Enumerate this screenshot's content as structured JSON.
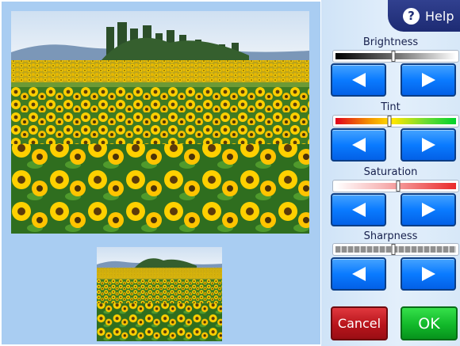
{
  "header": {
    "help_label": "Help",
    "help_icon": "question-mark-icon"
  },
  "adjustments": [
    {
      "label": "Brightness",
      "level": 0.48
    },
    {
      "label": "Tint",
      "level": 0.45
    },
    {
      "label": "Saturation",
      "level": 0.52
    },
    {
      "label": "Sharpness",
      "level": 0.48
    }
  ],
  "actions": {
    "cancel_label": "Cancel",
    "ok_label": "OK"
  },
  "colors": {
    "accent_blue": "#0a7bff",
    "cancel_red": "#b8151c",
    "ok_green": "#12b82a",
    "help_navy": "#1d2b73"
  }
}
